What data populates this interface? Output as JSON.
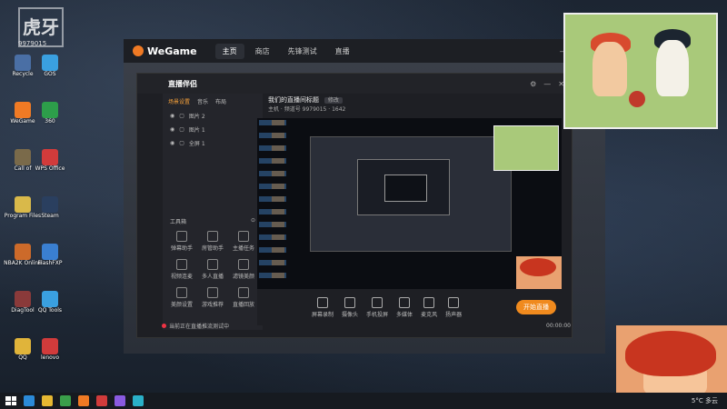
{
  "desktop_icons": [
    {
      "label": "Recycle",
      "color": "#4a6fa5"
    },
    {
      "label": "GOS",
      "color": "#3aa0e0"
    },
    {
      "label": "WeGame",
      "color": "#f07a24"
    },
    {
      "label": "360",
      "color": "#2d9e4a"
    },
    {
      "label": "Call of",
      "color": "#7a6a4a"
    },
    {
      "label": "WPS Office",
      "color": "#d13b3b"
    },
    {
      "label": "Program Files",
      "color": "#d9b94a"
    },
    {
      "label": "Steam",
      "color": "#2a3f5f"
    },
    {
      "label": "NBA2K Online",
      "color": "#cc6a2a"
    },
    {
      "label": "FlashFXP",
      "color": "#3a7fd1"
    },
    {
      "label": "DiagTool",
      "color": "#8a3a3a"
    },
    {
      "label": "QQ Tools",
      "color": "#3aa0e0"
    },
    {
      "label": "QQ",
      "color": "#e0b43a"
    },
    {
      "label": "lenovo",
      "color": "#d13b3b"
    }
  ],
  "watermark": {
    "text": "虎牙",
    "id": "9979015"
  },
  "wegame": {
    "brand": "WeGame",
    "nav": [
      "主页",
      "商店",
      "先锋测试",
      "直播"
    ],
    "active_nav": "主页"
  },
  "live_app": {
    "brand": "直播伴侣",
    "tabs": [
      "场景设置",
      "音乐",
      "布局"
    ],
    "scenes": [
      "图片 2",
      "图片 1",
      "全屏 1"
    ],
    "title": "我们的直播间标题",
    "edit_label": "修改",
    "meta": "主机 · 频道号 9979015 · 1642",
    "tools_header": "工具箱",
    "tools": [
      "弹幕助手",
      "房管助手",
      "主播任务",
      "视频连麦",
      "多人直播",
      "滤镜美颜",
      "美颜设置",
      "游戏推荐",
      "直播回放"
    ],
    "controls": [
      "屏幕录制",
      "摄像头",
      "手机投屏",
      "多媒体",
      "麦克风",
      "扬声器"
    ],
    "start_label": "开始直播",
    "status_text": "当前正在直播推流测试中",
    "timer": "00:00:00"
  },
  "taskbar": {
    "weather": "5°C 多云",
    "colors": [
      "#2b8ad8",
      "#e6b832",
      "#3a9e4a",
      "#f07a24",
      "#d13b3b",
      "#8a5ae0",
      "#2ab0c8"
    ]
  }
}
